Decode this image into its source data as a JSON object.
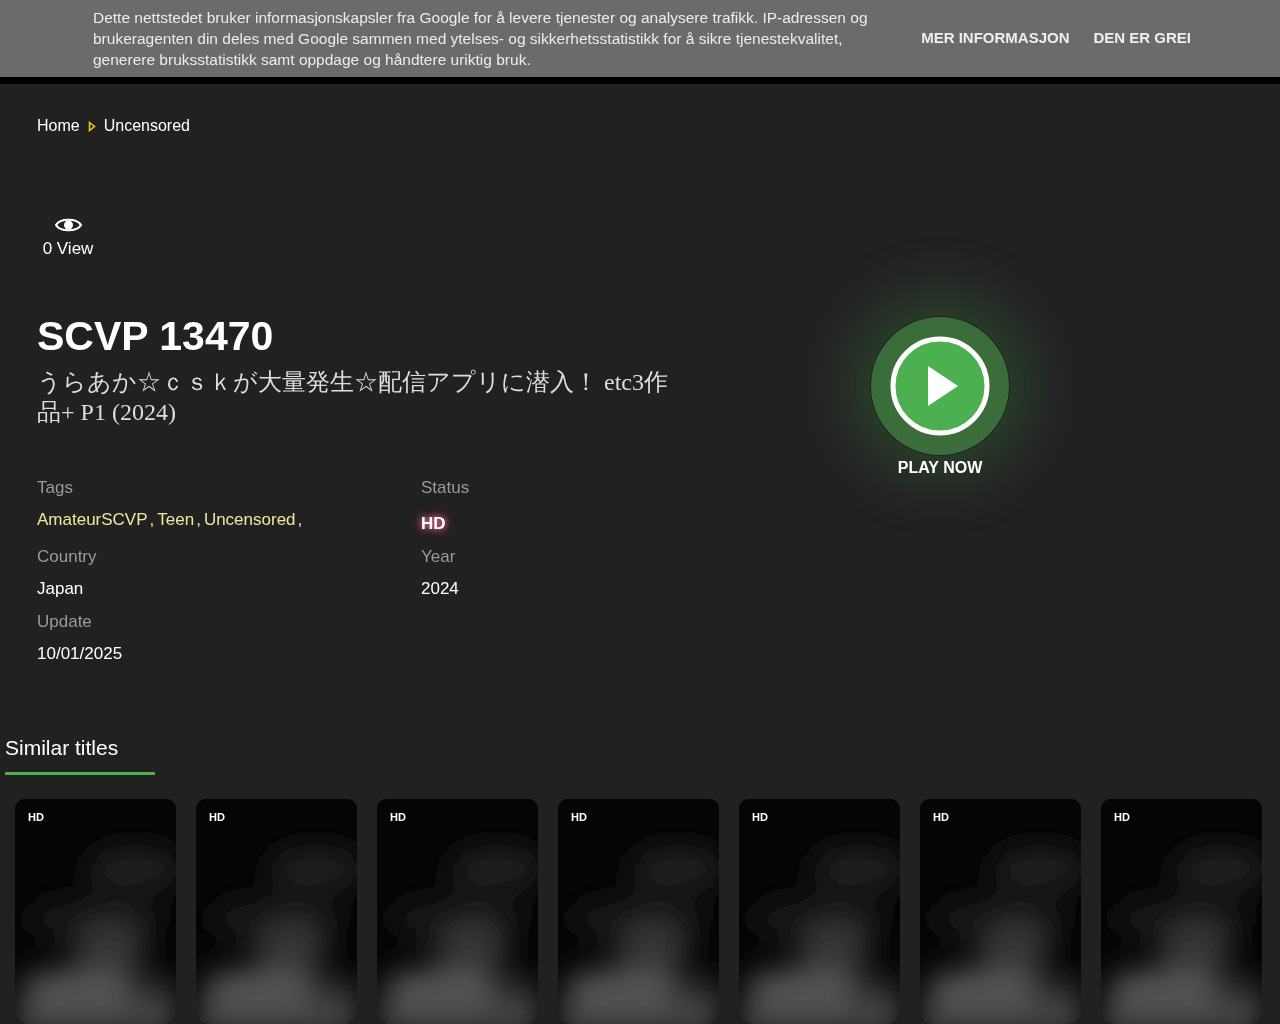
{
  "cookie_banner": {
    "message": "Dette nettstedet bruker informasjonskapsler fra Google for å levere tjenester og analysere trafikk. IP-adressen og brukeragenten din deles med Google sammen med ytelses- og sikkerhetsstatistikk for å sikre tjenestekvalitet, generere bruksstatistikk samt oppdage og håndtere uriktig bruk.",
    "buttons": [
      "MER INFORMASJON",
      "DEN ER GREI"
    ]
  },
  "breadcrumb": [
    {
      "label": "Home"
    },
    {
      "label": "Uncensored"
    }
  ],
  "views": "0 View",
  "title": "SCVP 13470",
  "subtitle": "うらあか☆ｃｓｋが大量発生☆配信アプリに潜入！ etc3作品+ P1 (2024)",
  "details": [
    {
      "label": "Tags",
      "kind": "tags",
      "tags": [
        {
          "label": "AmateurSCVP",
          "separator": ","
        },
        {
          "label": "Teen",
          "separator": ","
        },
        {
          "label": "Uncensored",
          "separator": ","
        }
      ]
    },
    {
      "label": "Status",
      "kind": "badge",
      "value": "HD"
    },
    {
      "label": "Country",
      "kind": "text",
      "value": "Japan"
    },
    {
      "label": "Year",
      "kind": "text",
      "value": "2024"
    },
    {
      "label": "Update",
      "kind": "text",
      "value": "10/01/2025"
    }
  ],
  "play_button": {
    "label": "PLAY NOW"
  },
  "similar": {
    "heading": "Similar titles",
    "items": [
      {
        "badge": "HD",
        "kind": "picture"
      },
      {
        "badge": "HD",
        "kind": "picture"
      },
      {
        "badge": "HD",
        "kind": "picture"
      },
      {
        "badge": "HD",
        "kind": "picture"
      },
      {
        "badge": "HD",
        "kind": "picture"
      },
      {
        "badge": "HD",
        "kind": "picture"
      },
      {
        "badge": "HD",
        "kind": "picture"
      }
    ]
  }
}
